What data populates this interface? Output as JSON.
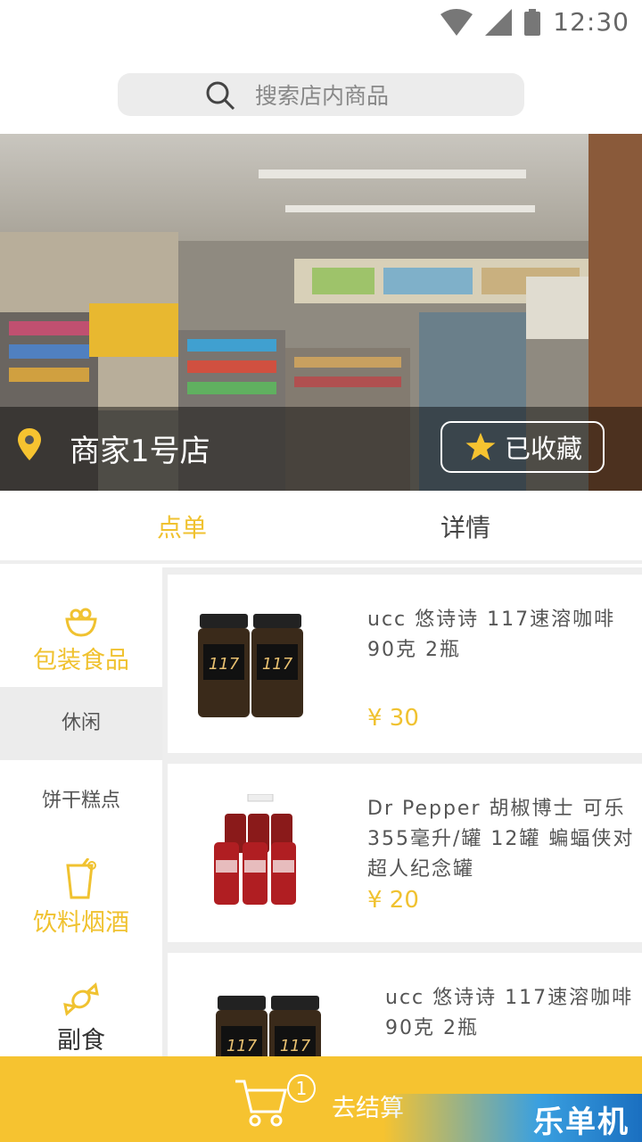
{
  "status_bar": {
    "time": "12:30"
  },
  "search": {
    "placeholder": "搜索店内商品"
  },
  "store": {
    "name": "商家1号店",
    "favorite_label": "已收藏"
  },
  "tabs": [
    {
      "label": "点单",
      "active": true
    },
    {
      "label": "详情",
      "active": false
    }
  ],
  "sidebar": {
    "categories": [
      {
        "label": "包装食品",
        "icon": "snack-bowl-icon",
        "primary": true
      },
      {
        "label": "休闲",
        "primary": false,
        "selected": true
      },
      {
        "label": "饼干糕点",
        "primary": false
      },
      {
        "label": "饮料烟酒",
        "icon": "drink-cup-icon",
        "primary": true
      },
      {
        "label": "副食",
        "icon": "candy-icon",
        "primary": false
      }
    ]
  },
  "products": [
    {
      "name": "ucc 悠诗诗 117速溶咖啡 90克 2瓶",
      "price": "¥ 30",
      "image": "coffee-jars"
    },
    {
      "name": "Dr Pepper 胡椒博士 可乐 355毫升/罐 12罐 蝙蝠侠对超人纪念罐",
      "price": "¥ 20",
      "image": "soda-cans"
    },
    {
      "name": "ucc 悠诗诗 117速溶咖啡 90克 2瓶",
      "price": "",
      "image": "coffee-jars"
    }
  ],
  "cart": {
    "count": "1",
    "checkout_label": "去结算"
  },
  "watermark": {
    "text": "乐单机"
  },
  "colors": {
    "accent": "#f6c330",
    "accent_text": "#f0c230"
  }
}
